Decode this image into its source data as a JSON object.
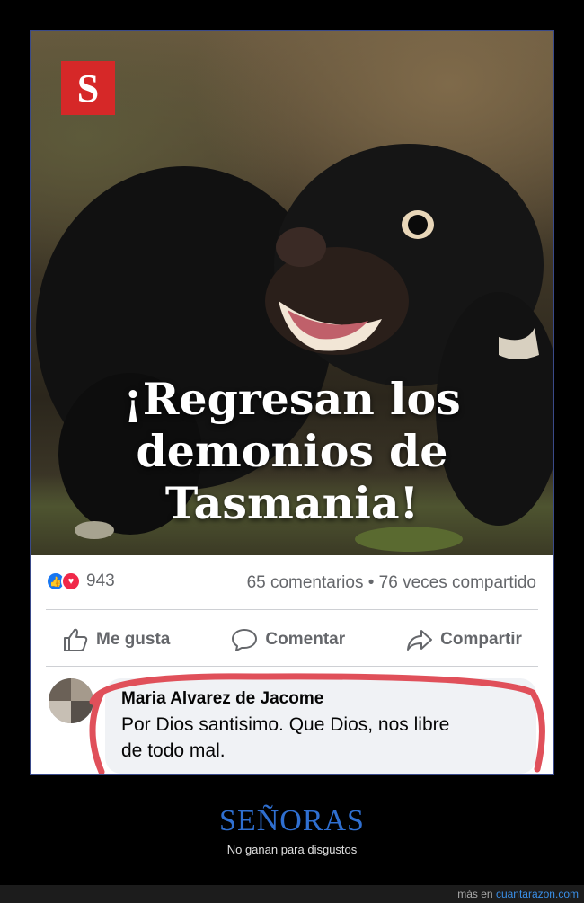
{
  "post": {
    "logo_letter": "S",
    "headline_lines": [
      "¡Regresan los",
      "demonios de",
      "Tasmania!"
    ],
    "reactions_count": "943",
    "comments_shares": "65 comentarios • 76 veces compartido",
    "actions": {
      "like": "Me gusta",
      "comment": "Comentar",
      "share": "Compartir"
    },
    "comment": {
      "author": "Maria Alvarez de Jacome",
      "text_line1": "Por Dios santisimo. Que Dios, nos libre",
      "text_line2": "de todo mal."
    },
    "colors": {
      "like_blue": "#1877f2",
      "love_red": "#f02849",
      "logo_red": "#d62828",
      "annotation_red": "#e0505a"
    }
  },
  "caption": {
    "title": "SEÑORAS",
    "subtitle": "No ganan para disgustos"
  },
  "footer": {
    "prefix": "más en",
    "site": "cuantarazon.com"
  }
}
